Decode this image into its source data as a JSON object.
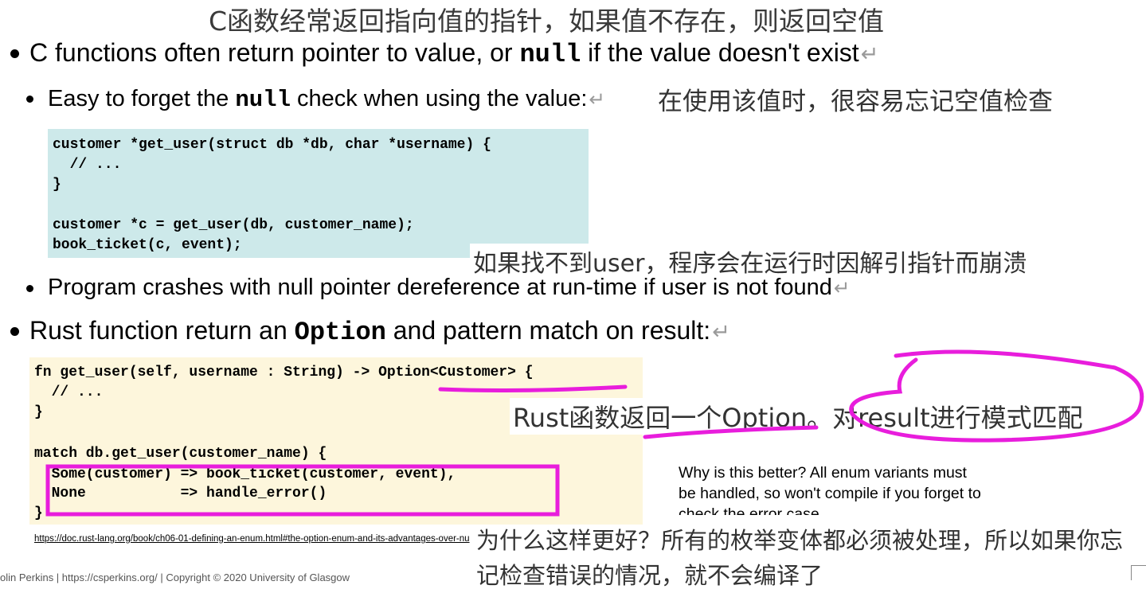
{
  "slide": {
    "title_zh": "C函数经常返回指向值的指针，如果值不存在，则返回空值",
    "bullet1": {
      "pre": "C functions often return pointer to value, or ",
      "code": "null",
      "post": " if the value doesn't exist"
    },
    "bullet1_1": {
      "pre": "Easy to forget the ",
      "code": "null",
      "post": " check when using the value:"
    },
    "bullet1_1_zh": "在使用该值时，很容易忘记空值检查",
    "code_c": [
      "customer *get_user(struct db *db, char *username) {",
      "  // ...",
      "}",
      "",
      "customer *c = get_user(db, customer_name);",
      "book_ticket(c, event);"
    ],
    "crash_zh": "如果找不到user，程序会在运行时因解引指针而崩溃",
    "bullet1_2": "Program crashes with null pointer dereference at run-time if user is not found",
    "bullet2": {
      "pre": "Rust function return an ",
      "code": "Option",
      "post": " and pattern match on result:"
    },
    "code_rust": [
      "fn get_user(self, username : String) -> Option<Customer> {",
      "  // ...",
      "}",
      "",
      "match db.get_user(customer_name) {",
      "  Some(customer) => book_ticket(customer, event),",
      "  None           => handle_error()",
      "}"
    ],
    "rust_zh": "Rust函数返回一个Option。对result进行模式匹配",
    "note": "Why is this better? All enum variants must be handled, so won't compile if you forget to check the error case",
    "note_zh": "为什么这样更好？所有的枚举变体都必须被处理，所以如果你忘记检查错误的情况，就不会编译了",
    "link": "https://doc.rust-lang.org/book/ch06-01-defining-an-enum.html#the-option-enum-and-its-advantages-over-nu",
    "footer": "olin Perkins | https://csperkins.org/ | Copyright © 2020 University of Glasgow"
  },
  "colors": {
    "code_c_bg": "#cde9ea",
    "code_rust_bg": "#fdf6dc",
    "annotation": "#e81ddc",
    "spellcheck": "#d22"
  }
}
